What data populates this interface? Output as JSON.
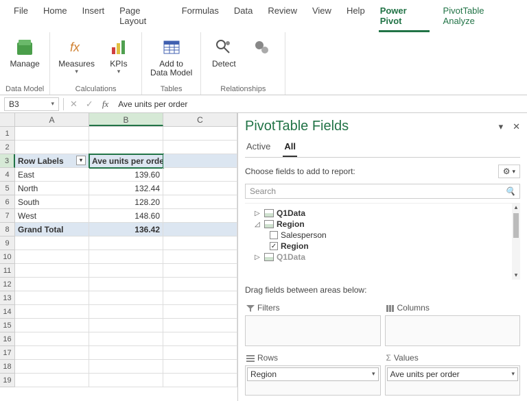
{
  "tabs": [
    "File",
    "Home",
    "Insert",
    "Page Layout",
    "Formulas",
    "Data",
    "Review",
    "View",
    "Help",
    "Power Pivot",
    "PivotTable Analyze"
  ],
  "active_tab_index": 9,
  "ribbon": {
    "groups": [
      {
        "label": "Data Model",
        "items": [
          {
            "label": "Manage",
            "icon": "cube"
          }
        ]
      },
      {
        "label": "Calculations",
        "items": [
          {
            "label": "Measures",
            "icon": "fx",
            "dd": true
          },
          {
            "label": "KPIs",
            "icon": "kpi",
            "dd": true
          }
        ]
      },
      {
        "label": "Tables",
        "items": [
          {
            "label": "Add to\nData Model",
            "icon": "table"
          }
        ]
      },
      {
        "label": "Relationships",
        "items": [
          {
            "label": "Detect",
            "icon": "detect"
          },
          {
            "label": "",
            "icon": "gears"
          }
        ]
      }
    ]
  },
  "formula_bar": {
    "namebox": "B3",
    "text": "Ave units per order"
  },
  "grid": {
    "columns": [
      "A",
      "B",
      "C"
    ],
    "active": {
      "row": 3,
      "col": "B"
    },
    "rows": [
      {
        "n": 1,
        "A": "",
        "B": "",
        "C": ""
      },
      {
        "n": 2,
        "A": "",
        "B": "",
        "C": ""
      },
      {
        "n": 3,
        "A": "Row Labels",
        "B": "Ave units per order",
        "C": "",
        "hdr": true
      },
      {
        "n": 4,
        "A": "East",
        "B": "139.60",
        "C": ""
      },
      {
        "n": 5,
        "A": "North",
        "B": "132.44",
        "C": ""
      },
      {
        "n": 6,
        "A": "South",
        "B": "128.20",
        "C": ""
      },
      {
        "n": 7,
        "A": "West",
        "B": "148.60",
        "C": ""
      },
      {
        "n": 8,
        "A": "Grand Total",
        "B": "136.42",
        "C": "",
        "hdr": true
      },
      {
        "n": 9
      },
      {
        "n": 10
      },
      {
        "n": 11
      },
      {
        "n": 12
      },
      {
        "n": 13
      },
      {
        "n": 14
      },
      {
        "n": 15
      },
      {
        "n": 16
      },
      {
        "n": 17
      },
      {
        "n": 18
      },
      {
        "n": 19
      }
    ]
  },
  "taskpane": {
    "title": "PivotTable Fields",
    "tabs": [
      "Active",
      "All"
    ],
    "active_tab": 1,
    "choose_label": "Choose fields to add to report:",
    "search_placeholder": "Search",
    "fields": [
      {
        "type": "table",
        "name": "Q1Data",
        "expanded": false
      },
      {
        "type": "table",
        "name": "Region",
        "expanded": true,
        "children": [
          {
            "name": "Salesperson",
            "checked": false
          },
          {
            "name": "Region",
            "checked": true
          }
        ]
      },
      {
        "type": "table",
        "name": "Q1Data",
        "expanded": false,
        "faded": true
      }
    ],
    "drag_label": "Drag fields between areas below:",
    "areas": {
      "filters": {
        "label": "Filters",
        "items": []
      },
      "columns": {
        "label": "Columns",
        "items": []
      },
      "rows": {
        "label": "Rows",
        "items": [
          "Region"
        ]
      },
      "values": {
        "label": "Values",
        "items": [
          "Ave units per order"
        ]
      }
    }
  }
}
